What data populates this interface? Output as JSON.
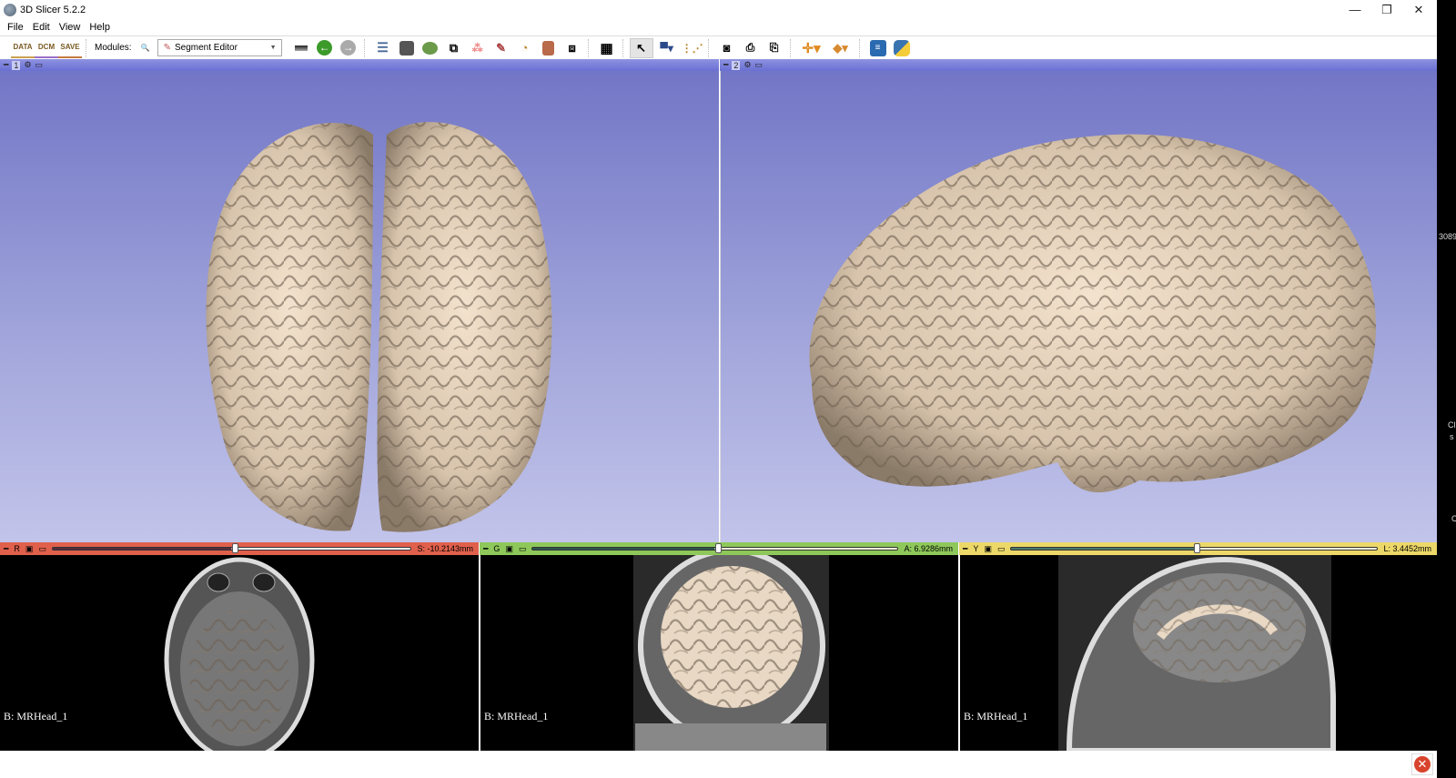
{
  "window": {
    "title": "3D Slicer 5.2.2",
    "minimize": "—",
    "restore": "❐",
    "close": "✕"
  },
  "menu": [
    "File",
    "Edit",
    "View",
    "Help"
  ],
  "toolbar": {
    "data": "DATA",
    "dcm": "DCM",
    "save": "SAVE",
    "modules_label": "Modules:",
    "module_selected": "Segment Editor"
  },
  "views3d": [
    {
      "id": "1"
    },
    {
      "id": "2"
    }
  ],
  "slices": [
    {
      "letter": "R",
      "offset": "S: -10.2143mm",
      "color": "#e0604c",
      "position": 0.5,
      "label": "B: MRHead_1"
    },
    {
      "letter": "G",
      "offset": "A: 6.9286mm",
      "color": "#8ec85a",
      "position": 0.5,
      "label": "B: MRHead_1"
    },
    {
      "letter": "Y",
      "offset": "L: 3.4452mm",
      "color": "#ecd868",
      "position": 0.5,
      "label": "B: MRHead_1"
    }
  ],
  "right_strip": {
    "t1": "3089",
    "t2": "Cl",
    "t3": "s",
    "t4": "C"
  },
  "colors": {
    "view_bg_top": "#7276c6",
    "view_bg_bottom": "#c2c4ea",
    "brain": "#efdcc6"
  }
}
